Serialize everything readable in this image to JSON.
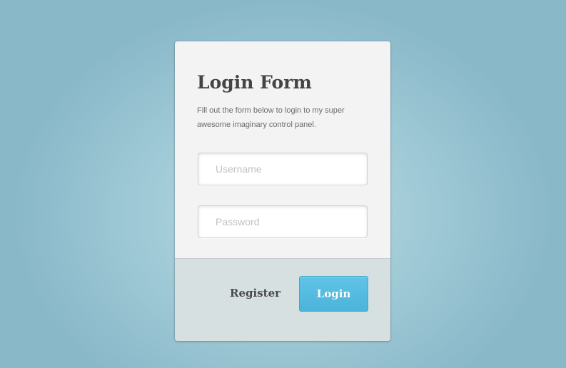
{
  "form": {
    "title": "Login Form",
    "description": "Fill out the form below to login to my super awesome imaginary control panel.",
    "username": {
      "placeholder": "Username",
      "value": ""
    },
    "password": {
      "placeholder": "Password",
      "value": ""
    },
    "register_label": "Register",
    "login_label": "Login"
  },
  "colors": {
    "background": "#a3ccd8",
    "card": "#f3f3f3",
    "footer": "#d7e0e1",
    "accent": "#55bce2",
    "title_text": "#444444"
  }
}
